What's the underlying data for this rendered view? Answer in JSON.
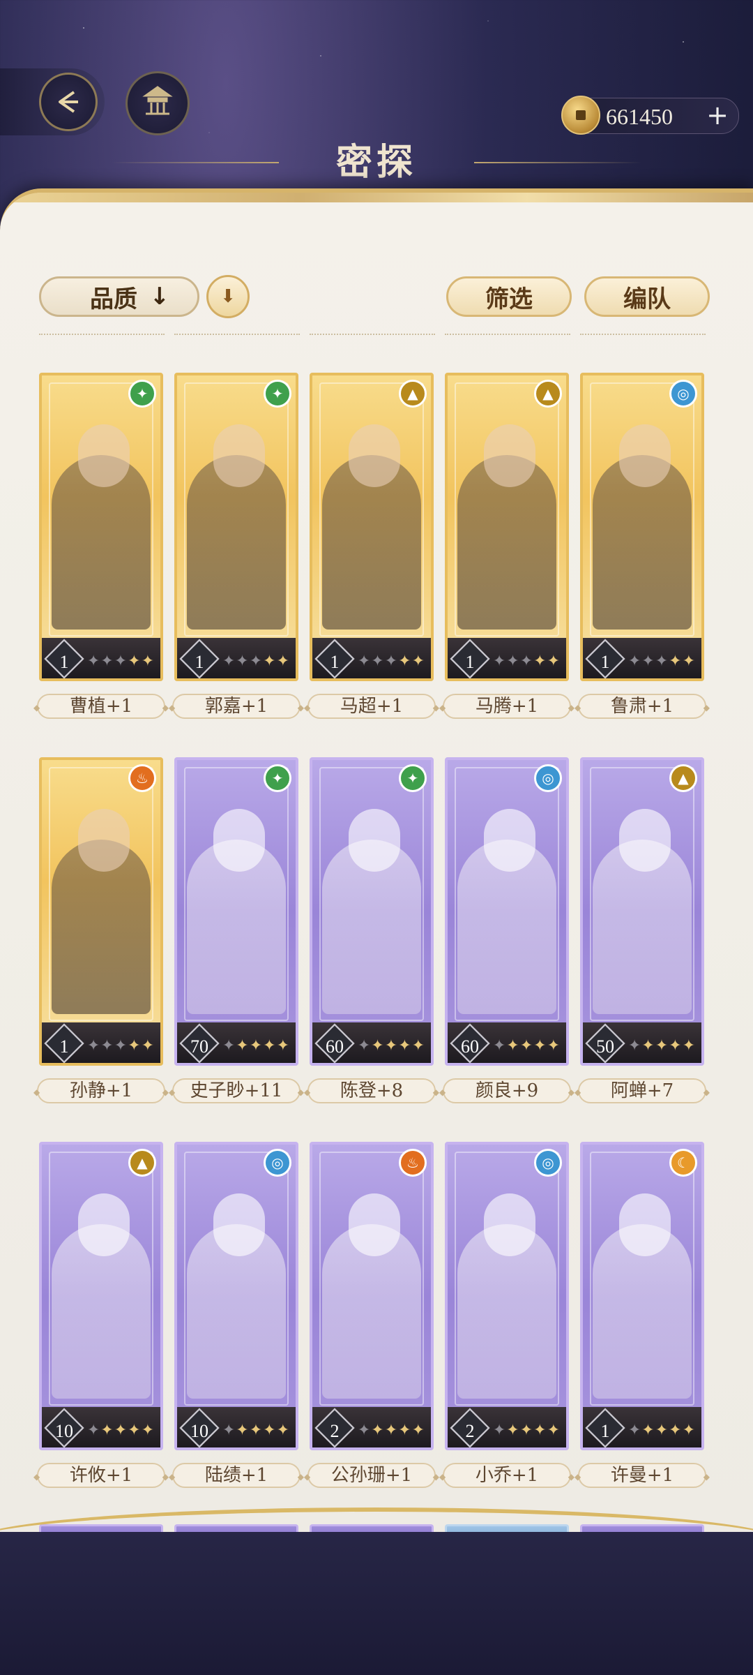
{
  "header": {
    "title": "密探",
    "currency": {
      "amount": "661450",
      "plus": "+"
    }
  },
  "controls": {
    "sort_label": "品质",
    "sort_arrow": "↓",
    "filter_label": "筛选",
    "team_label": "编队"
  },
  "colors": {
    "gold_accent": "#d6b46a",
    "panel_bg": "#f4f1ea",
    "night_bg": "#1c1d3b",
    "rarity_gold": "#f2c45e",
    "rarity_purple": "#9a85d8"
  },
  "cards": [
    {
      "name": "曹植+1",
      "level": "1",
      "rarity": "gold",
      "element": "wind",
      "stars_lit": 2
    },
    {
      "name": "郭嘉+1",
      "level": "1",
      "rarity": "gold",
      "element": "wind",
      "stars_lit": 2
    },
    {
      "name": "马超+1",
      "level": "1",
      "rarity": "gold",
      "element": "earth",
      "stars_lit": 2
    },
    {
      "name": "马腾+1",
      "level": "1",
      "rarity": "gold",
      "element": "earth",
      "stars_lit": 2
    },
    {
      "name": "鲁肃+1",
      "level": "1",
      "rarity": "gold",
      "element": "water",
      "stars_lit": 2
    },
    {
      "name": "孙静+1",
      "level": "1",
      "rarity": "gold",
      "element": "fire",
      "stars_lit": 2
    },
    {
      "name": "史子眇+11",
      "level": "70",
      "rarity": "purple",
      "element": "wind",
      "stars_lit": 4
    },
    {
      "name": "陈登+8",
      "level": "60",
      "rarity": "purple",
      "element": "wind",
      "stars_lit": 4
    },
    {
      "name": "颜良+9",
      "level": "60",
      "rarity": "purple",
      "element": "water",
      "stars_lit": 4
    },
    {
      "name": "阿蝉+7",
      "level": "50",
      "rarity": "purple",
      "element": "earth",
      "stars_lit": 4
    },
    {
      "name": "许攸+1",
      "level": "10",
      "rarity": "purple",
      "element": "earth",
      "stars_lit": 4
    },
    {
      "name": "陆绩+1",
      "level": "10",
      "rarity": "purple",
      "element": "water",
      "stars_lit": 4
    },
    {
      "name": "公孙珊+1",
      "level": "2",
      "rarity": "purple",
      "element": "fire",
      "stars_lit": 4
    },
    {
      "name": "小乔+1",
      "level": "2",
      "rarity": "purple",
      "element": "water",
      "stars_lit": 4
    },
    {
      "name": "许曼+1",
      "level": "1",
      "rarity": "purple",
      "element": "moon",
      "stars_lit": 4
    }
  ],
  "icons": {
    "back": "back-arrow-icon",
    "home": "pavilion-icon",
    "coin": "coin-icon",
    "order": "sort-order-icon",
    "elements": {
      "wind": "✦",
      "earth": "▲",
      "water": "◎",
      "fire": "♨",
      "moon": "☾"
    }
  }
}
